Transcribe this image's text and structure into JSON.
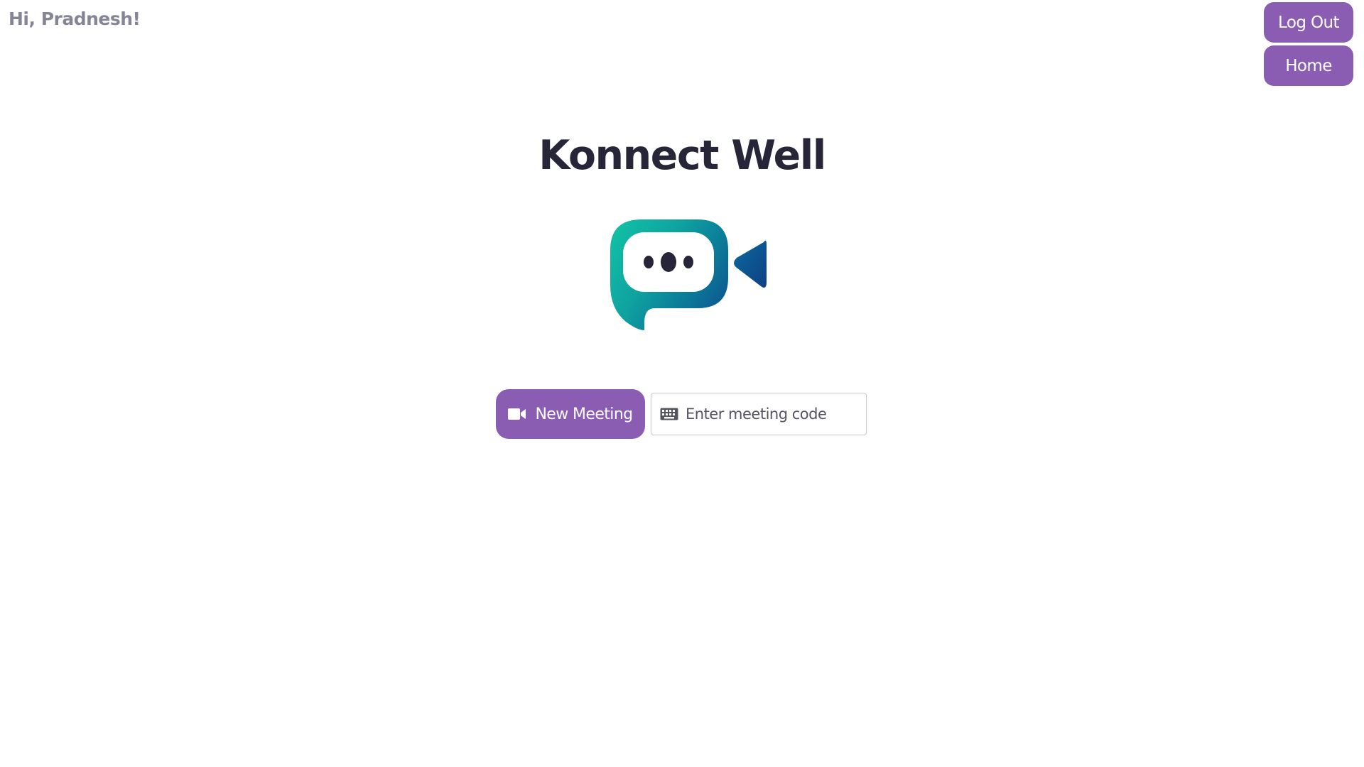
{
  "header": {
    "greeting": "Hi, Pradnesh!",
    "logout_label": "Log Out",
    "home_label": "Home"
  },
  "main": {
    "title": "Konnect Well",
    "logo_icon": "video-chat-logo-icon",
    "new_meeting_label": "New Meeting",
    "new_meeting_icon": "video-camera-icon",
    "meeting_code": {
      "placeholder": "Enter meeting code",
      "value": "",
      "icon": "keyboard-icon"
    }
  },
  "colors": {
    "accent": "#8a5db3",
    "title": "#262638",
    "greeting": "#858597",
    "logo_teal": "#14b7a4",
    "logo_blue": "#0d4d8c"
  }
}
